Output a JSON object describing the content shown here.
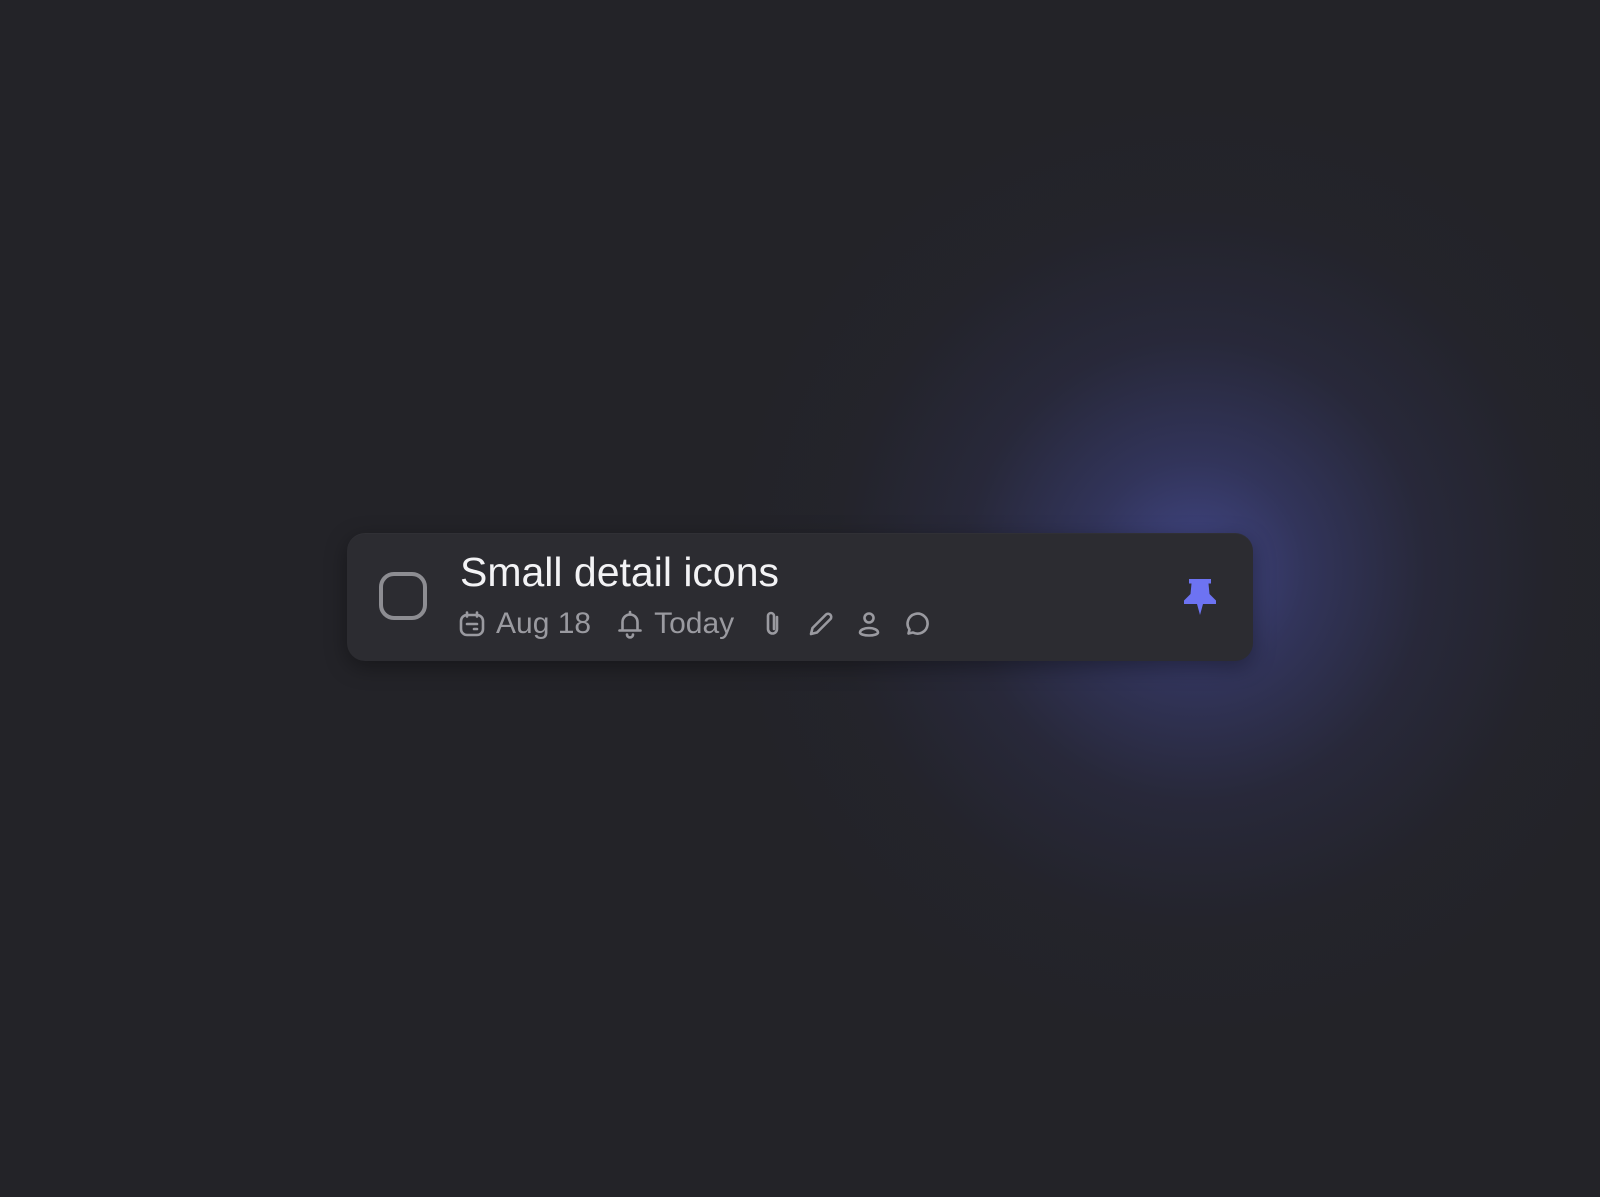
{
  "task": {
    "title": "Small detail icons",
    "checked": false,
    "due_date": "Aug 18",
    "reminder": "Today",
    "icons": {
      "due_date": "calendar-icon",
      "reminder": "bell-icon",
      "attachment": "paperclip-icon",
      "note": "pencil-icon",
      "assignee": "person-icon",
      "comment": "comment-bubble-icon",
      "pin": "pushpin-icon"
    },
    "pinned": true
  },
  "colors": {
    "background": "#232328",
    "card": "#2c2c31",
    "title_text": "#f3f3f5",
    "meta_text": "#9a9aa0",
    "accent": "#6d73f2"
  }
}
